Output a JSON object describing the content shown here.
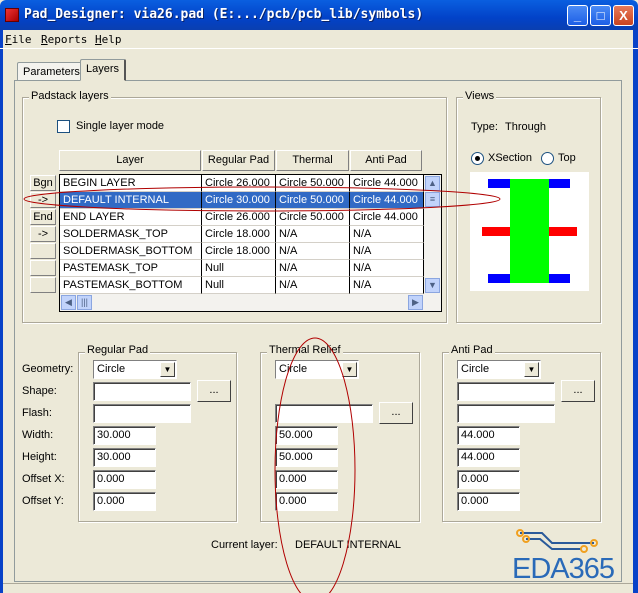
{
  "window": {
    "title": "Pad_Designer: via26.pad (E:.../pcb/pcb_lib/symbols)",
    "minimize": "_",
    "maximize": "□",
    "close": "X"
  },
  "menu": [
    "File",
    "Reports",
    "Help"
  ],
  "tabs": [
    {
      "label": "Parameters",
      "active": false
    },
    {
      "label": "Layers",
      "active": true
    }
  ],
  "padstack": {
    "group_label": "Padstack layers",
    "single_layer_mode": {
      "label": "Single layer mode",
      "checked": false
    },
    "columns": [
      "Layer",
      "Regular Pad",
      "Thermal Relief",
      "Anti Pad"
    ],
    "rows": [
      {
        "button": "Bgn",
        "layer": "BEGIN LAYER",
        "regular": "Circle 26.000",
        "thermal": "Circle 50.000",
        "anti": "Circle 44.000"
      },
      {
        "button": "->",
        "layer": "DEFAULT INTERNAL",
        "regular": "Circle 30.000",
        "thermal": "Circle 50.000",
        "anti": "Circle 44.000",
        "selected": true
      },
      {
        "button": "End",
        "layer": "END LAYER",
        "regular": "Circle 26.000",
        "thermal": "Circle 50.000",
        "anti": "Circle 44.000"
      },
      {
        "button": "->",
        "layer": "SOLDERMASK_TOP",
        "regular": "Circle 18.000",
        "thermal": "N/A",
        "anti": "N/A"
      },
      {
        "button": "",
        "layer": "SOLDERMASK_BOTTOM",
        "regular": "Circle 18.000",
        "thermal": "N/A",
        "anti": "N/A"
      },
      {
        "button": "",
        "layer": "PASTEMASK_TOP",
        "regular": "Null",
        "thermal": "N/A",
        "anti": "N/A"
      },
      {
        "button": "",
        "layer": "PASTEMASK_BOTTOM",
        "regular": "Null",
        "thermal": "N/A",
        "anti": "N/A"
      }
    ]
  },
  "views": {
    "group_label": "Views",
    "type_label": "Type:",
    "type_value": "Through",
    "xsection": "XSection",
    "top": "Top",
    "selected": "XSection",
    "colors": {
      "drill": "#00ff00",
      "pad": "#0000ff",
      "internal": "#ff0000"
    }
  },
  "labels": {
    "geometry": "Geometry:",
    "shape": "Shape:",
    "flash": "Flash:",
    "width": "Width:",
    "height": "Height:",
    "offset_x": "Offset X:",
    "offset_y": "Offset Y:"
  },
  "regular_pad": {
    "label": "Regular Pad",
    "geometry": "Circle",
    "shape": "",
    "flash": "",
    "width": "30.000",
    "height": "30.000",
    "offset_x": "0.000",
    "offset_y": "0.000",
    "browse": "..."
  },
  "thermal_relief": {
    "label": "Thermal Relief",
    "geometry": "Circle",
    "flash": "",
    "width": "50.000",
    "height": "50.000",
    "offset_x": "0.000",
    "offset_y": "0.000",
    "browse": "..."
  },
  "anti_pad": {
    "label": "Anti Pad",
    "geometry": "Circle",
    "shape": "",
    "flash": "",
    "width": "44.000",
    "height": "44.000",
    "offset_x": "0.000",
    "offset_y": "0.000",
    "browse": "..."
  },
  "current_layer": {
    "label": "Current layer:",
    "value": "DEFAULT INTERNAL"
  },
  "watermark": "EDA365"
}
